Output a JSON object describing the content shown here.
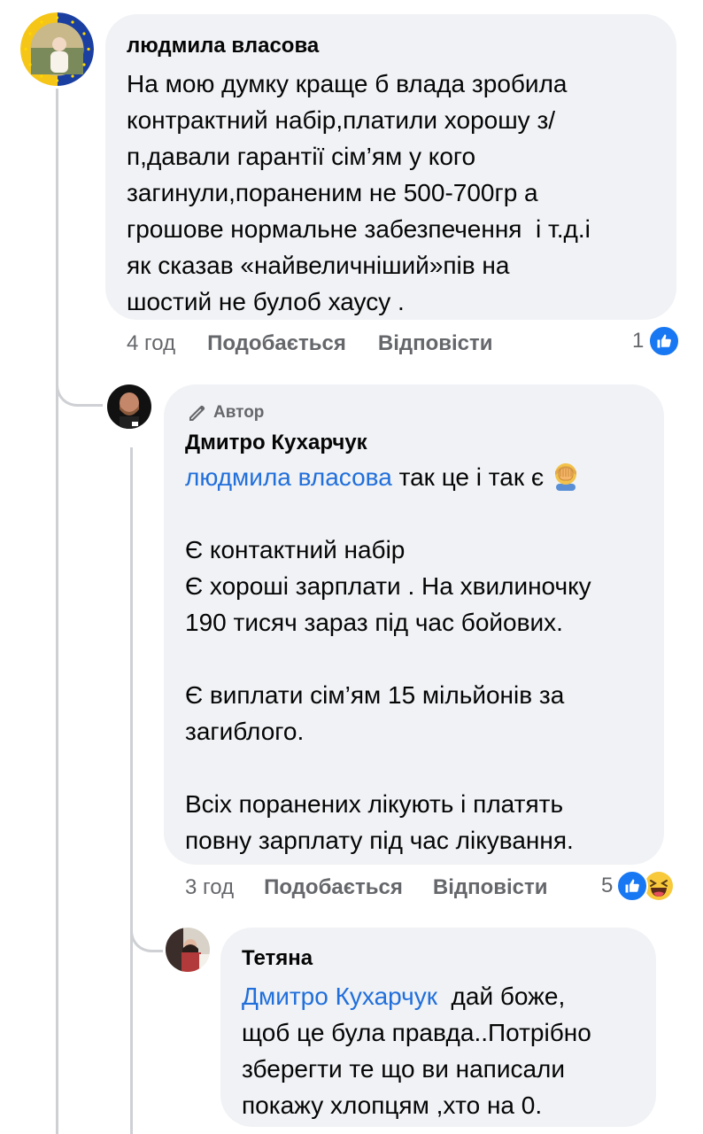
{
  "comments": [
    {
      "author": "людмила власова",
      "text": "На мою думку краще б влада зробила\nконтрактний набір,платили хорошу з/\nп,давали гарантії сім’ям у кого\nзагинули,пораненим не 500-700гр а\nгрошове нормальне забезпечення  і т.д.і\nяк сказав «найвеличніший»пів на\nшостий не булоб хаусу .",
      "time": "4 год",
      "like_label": "Подобається",
      "reply_label": "Відповісти",
      "reaction_count": "1"
    },
    {
      "author_badge": "Автор",
      "author": "Дмитро Кухарчук",
      "mention": "людмила власова",
      "text_after_mention": " так це і так є ",
      "text": "\n\nЄ контактний набір\nЄ хороші зарплати . На хвилиночку\n190 тисяч зараз під час бойових.\n\nЄ виплати сім’ям 15 мільйонів за\nзагиблого.\n\nВсіх поранених лікують і платять\nповну зарплату під час лікування.",
      "time": "3 год",
      "like_label": "Подобається",
      "reply_label": "Відповісти",
      "reaction_count": "5"
    },
    {
      "author": "Тетяна",
      "mention": "Дмитро Кухарчук",
      "text_after_mention": "  дай боже,\nщоб це була правда..Потрібно\nзберегти те що ви написали\nпокажу хлопцям ,хто на 0."
    }
  ],
  "icons": {
    "like": "like-icon",
    "haha": "haha-icon",
    "pen": "pen-icon",
    "facepalm": "facepalm-emoji"
  },
  "colors": {
    "bubble": "#f0f2f5",
    "mention": "#216fdb",
    "muted": "#65676b",
    "like_blue": "#1877f2",
    "thread_line": "#ced0d4"
  }
}
